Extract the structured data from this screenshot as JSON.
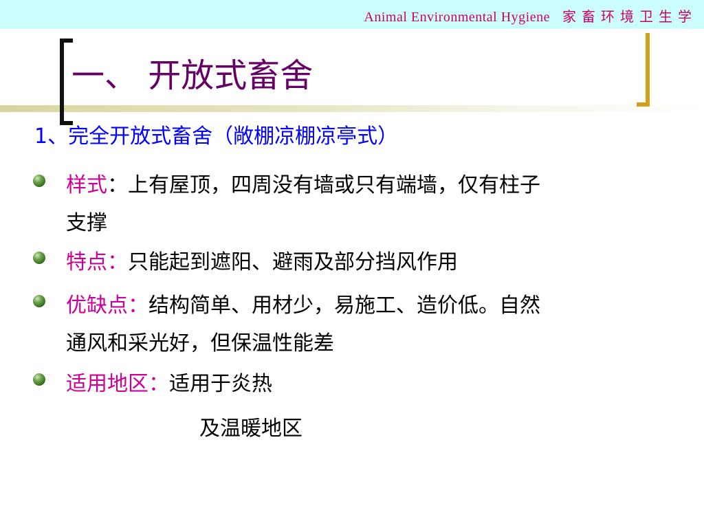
{
  "header": {
    "course_en": "Animal  Environmental  Hygiene",
    "course_cn": "家畜环境卫生学"
  },
  "title": "一、 开放式畜舍",
  "subtitle": "1、完全开放式畜舍（敞棚凉棚凉亭式）",
  "bullets": [
    {
      "label": "样式",
      "sep": "：",
      "text": "上有屋顶，四周没有墙或只有端墙，仅有柱子支撑"
    },
    {
      "label": "特点：",
      "sep": "",
      "text": "只能起到遮阳、避雨及部分挡风作用"
    },
    {
      "label": "优缺点：",
      "sep": "",
      "text": "结构简单、用材少，易施工、造价低。自然通风和采光好，但保温性能差"
    },
    {
      "label": "适用地区：",
      "sep": "",
      "text": "适用于炎热"
    }
  ],
  "extra_line": "及温暖地区",
  "colors": {
    "header_bg": "#ccfdfd",
    "header_text": "#cc0066",
    "title": "#660066",
    "subtitle": "#0000ff",
    "label": "#cc0099",
    "bracket_right": "#d4a017"
  }
}
